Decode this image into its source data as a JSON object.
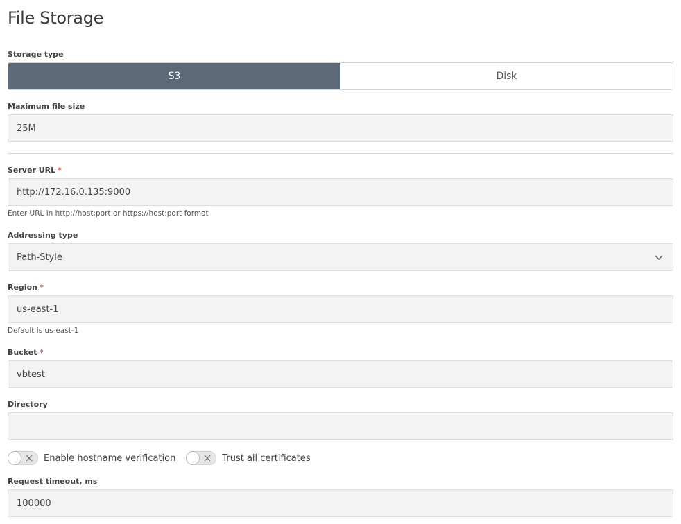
{
  "page": {
    "title": "File Storage"
  },
  "storage_type": {
    "label": "Storage type",
    "options": [
      {
        "label": "S3",
        "active": true
      },
      {
        "label": "Disk",
        "active": false
      }
    ]
  },
  "max_file_size": {
    "label": "Maximum file size",
    "value": "25M"
  },
  "server_url": {
    "label": "Server URL",
    "required_mark": "*",
    "value": "http://172.16.0.135:9000",
    "hint": "Enter URL in http://host:port or https://host:port format"
  },
  "addressing_type": {
    "label": "Addressing type",
    "value": "Path-Style",
    "icon": "chevron-down-icon"
  },
  "region": {
    "label": "Region",
    "required_mark": "*",
    "value": "us-east-1",
    "hint": "Default is us-east-1"
  },
  "bucket": {
    "label": "Bucket",
    "required_mark": "*",
    "value": "vbtest"
  },
  "directory": {
    "label": "Directory",
    "value": ""
  },
  "toggles": [
    {
      "label": "Enable hostname verification",
      "on": false
    },
    {
      "label": "Trust all certificates",
      "on": false
    }
  ],
  "request_timeout": {
    "label": "Request timeout, ms",
    "value": "100000"
  },
  "colors": {
    "active_segment": "#5c6a77",
    "field_background": "#f3f3f3",
    "required": "#d9534f"
  }
}
